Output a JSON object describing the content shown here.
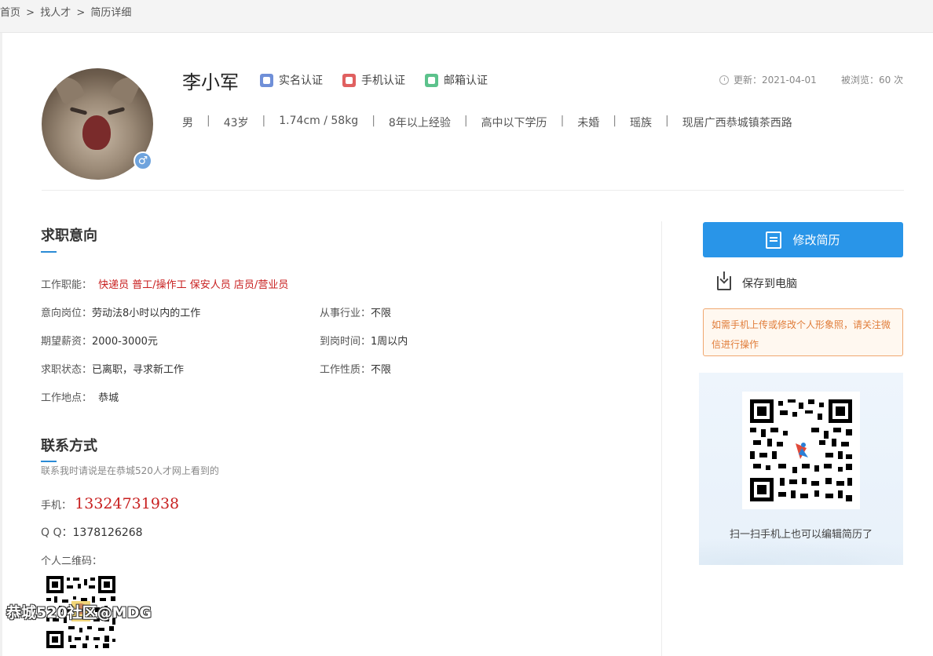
{
  "breadcrumb": {
    "home": "首页",
    "sep": ">",
    "talent": "找人才",
    "detail": "简历详细"
  },
  "profile": {
    "name": "李小军",
    "certs": [
      "实名认证",
      "手机认证",
      "邮箱认证"
    ],
    "update": "更新：2021-04-01",
    "views": "被浏览：60 次",
    "gender_symbol": "♂",
    "info": [
      "男",
      "43岁",
      "1.74cm / 58kg",
      "8年以上经验",
      "高中以下学历",
      "未婚",
      "瑶族",
      "现居广西恭城镇茶西路"
    ],
    "info_sep": "|"
  },
  "intent": {
    "title": "求职意向",
    "functions_label": "工作职能：",
    "functions_value": "快递员 普工/操作工 保安人员 店员/营业员",
    "position_label": "意向岗位：",
    "position_value": "劳动法8小时以内的工作",
    "industry_label": "从事行业：",
    "industry_value": "不限",
    "salary_label": "期望薪资：",
    "salary_value": "2000-3000元",
    "arrival_label": "到岗时间：",
    "arrival_value": "1周以内",
    "status_label": "求职状态：",
    "status_value": "已离职，寻求新工作",
    "nature_label": "工作性质：",
    "nature_value": "不限",
    "location_label": "工作地点：",
    "location_value": "恭城"
  },
  "contact": {
    "title": "联系方式",
    "subtitle": "联系我时请说是在恭城520人才网上看到的",
    "phone_label": "手机：",
    "phone_value": "13324731938",
    "qq_label": "Q Q：",
    "qq_value": "1378126268",
    "qr_label": "个人二维码："
  },
  "sidebar": {
    "edit_button": "修改简历",
    "save_label": "保存到电脑",
    "notice": "如需手机上传或修改个人形象照，请关注微信进行操作",
    "qr_caption": "扫一扫手机上也可以编辑简历了"
  },
  "watermark": "恭城520社区@MDG",
  "colors": {
    "accent": "#2995e8",
    "red": "#c82020",
    "notice": "#e07d3a"
  }
}
